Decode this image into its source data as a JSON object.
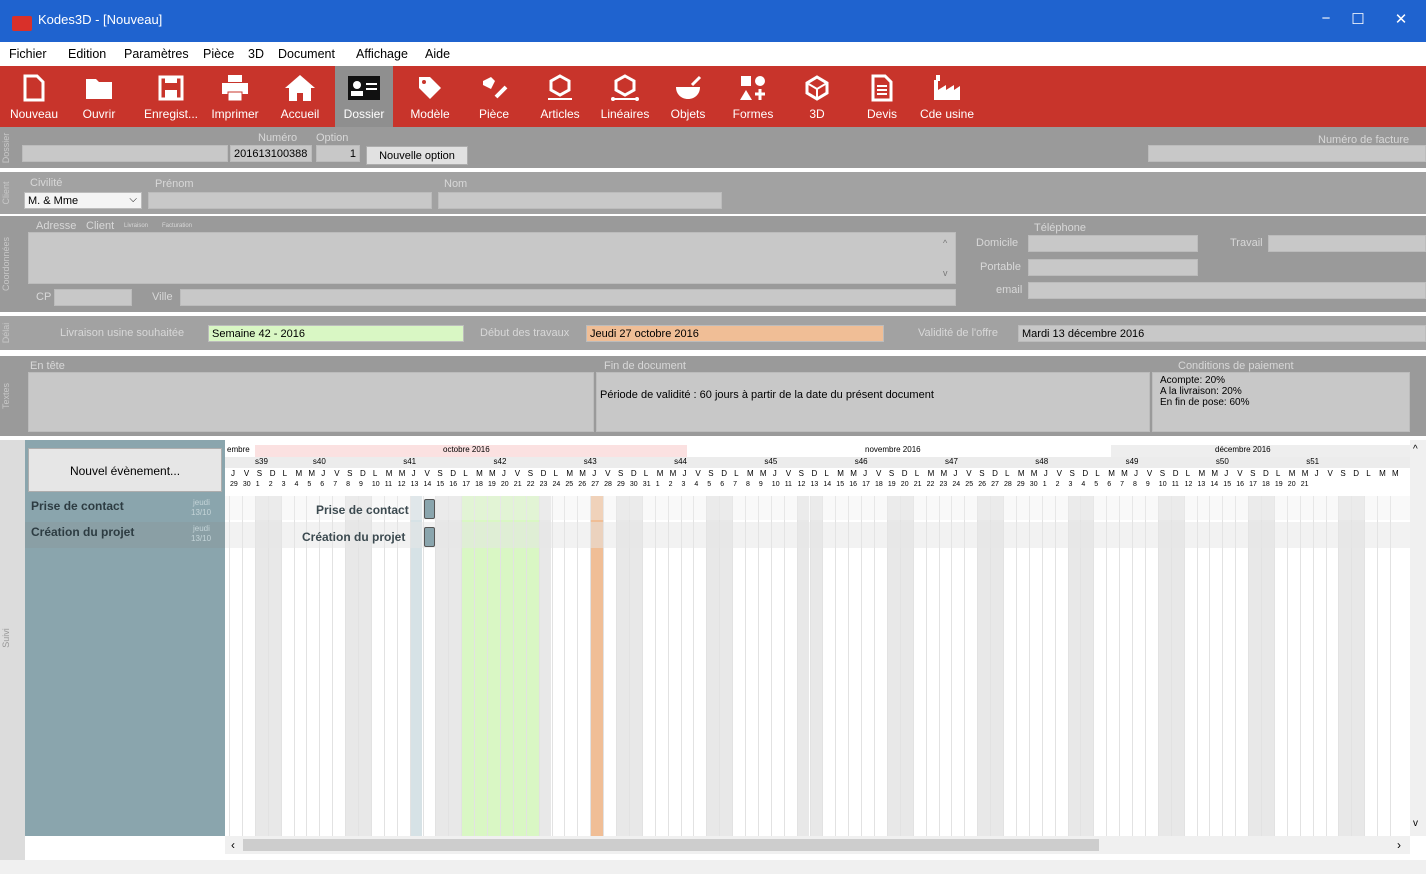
{
  "window": {
    "title": "Kodes3D - [Nouveau]",
    "min": "−",
    "max": "☐",
    "close": "✕"
  },
  "menu": [
    "Fichier",
    "Edition",
    "Paramètres",
    "Pièce",
    "3D",
    "Document",
    "Affichage",
    "Aide"
  ],
  "toolbar": [
    {
      "label": "Nouveau",
      "icon": "new-file-icon"
    },
    {
      "label": "Ouvrir",
      "icon": "folder-icon"
    },
    {
      "label": "Enregist...",
      "icon": "save-icon"
    },
    {
      "label": "Imprimer",
      "icon": "printer-icon"
    },
    {
      "label": "Accueil",
      "icon": "home-icon"
    },
    {
      "label": "Dossier",
      "icon": "id-card-icon"
    },
    {
      "label": "Modèle",
      "icon": "tag-icon"
    },
    {
      "label": "Pièce",
      "icon": "brush-icon"
    },
    {
      "label": "Articles",
      "icon": "articles-icon"
    },
    {
      "label": "Linéaires",
      "icon": "linear-icon"
    },
    {
      "label": "Objets",
      "icon": "objects-icon"
    },
    {
      "label": "Formes",
      "icon": "shapes-icon"
    },
    {
      "label": "3D",
      "icon": "cube-icon"
    },
    {
      "label": "Devis",
      "icon": "document-icon"
    },
    {
      "label": "Cde usine",
      "icon": "factory-icon"
    }
  ],
  "dossier": {
    "section": "Dossier",
    "numero_label": "Numéro",
    "numero": "201613100388",
    "option_label": "Option",
    "option": "1",
    "new_option": "Nouvelle option",
    "facture_label": "Numéro de facture"
  },
  "client": {
    "section": "Client",
    "civilite_label": "Civilité",
    "civilite": "M. & Mme",
    "prenom_label": "Prénom",
    "nom_label": "Nom"
  },
  "coordonnees": {
    "section": "Coordonnées",
    "adresse_label": "Adresse",
    "client_label": "Client",
    "livraison": "Livraison",
    "facturation": "Facturation",
    "cp_label": "CP",
    "ville_label": "Ville",
    "telephone_label": "Téléphone",
    "domicile_label": "Domicile",
    "portable_label": "Portable",
    "email_label": "email",
    "travail_label": "Travail"
  },
  "delai": {
    "section": "Délai",
    "livraison_label": "Livraison usine souhaitée",
    "livraison": "Semaine 42 - 2016",
    "debut_label": "Début des travaux",
    "debut": "Jeudi 27 octobre 2016",
    "validite_label": "Validité de l'offre",
    "validite": "Mardi 13 décembre 2016"
  },
  "textes": {
    "section": "Textes",
    "entete_label": "En tête",
    "fin_label": "Fin de document",
    "fin_text": "Période de validité  : 60 jours à partir de la date du présent document",
    "conditions_label": "Conditions de paiement",
    "conditions": [
      "Acompte: 20%",
      "A la livraison: 20%",
      "En fin de pose: 60%"
    ]
  },
  "suivi": {
    "section": "Suivi",
    "new_event": "Nouvel évènement...",
    "events": [
      {
        "name": "Prise de contact",
        "date1": "jeudi",
        "date2": "13/10"
      },
      {
        "name": "Création du projet",
        "date1": "jeudi",
        "date2": "13/10"
      }
    ],
    "months": [
      "embre",
      "octobre 2016",
      "novembre 2016",
      "décembre 2016"
    ],
    "weeks": [
      "s39",
      "s40",
      "s41",
      "s42",
      "s43",
      "s44",
      "s45",
      "s46",
      "s47",
      "s48",
      "s49",
      "s50",
      "s51"
    ],
    "days": [
      "J",
      "V",
      "S",
      "D",
      "L",
      "M",
      "M",
      "J",
      "V",
      "S",
      "D",
      "L",
      "M",
      "M",
      "J",
      "V",
      "S",
      "D",
      "L",
      "M",
      "M",
      "J",
      "V",
      "S",
      "D",
      "L",
      "M",
      "M",
      "J",
      "V",
      "S",
      "D",
      "L",
      "M",
      "M",
      "J",
      "V",
      "S",
      "D",
      "L",
      "M",
      "M",
      "J",
      "V",
      "S",
      "D",
      "L",
      "M",
      "M",
      "J",
      "V",
      "S",
      "D",
      "L",
      "M",
      "M",
      "J",
      "V",
      "S",
      "D",
      "L",
      "M",
      "M",
      "J",
      "V",
      "S",
      "D",
      "L",
      "M",
      "M",
      "J",
      "V",
      "S",
      "D",
      "L",
      "M",
      "M",
      "J",
      "V",
      "S",
      "D",
      "L",
      "M",
      "M",
      "J",
      "V",
      "S",
      "D",
      "L",
      "M",
      "M"
    ],
    "dates": [
      "29",
      "30",
      "1",
      "2",
      "3",
      "4",
      "5",
      "6",
      "7",
      "8",
      "9",
      "10",
      "11",
      "12",
      "13",
      "14",
      "15",
      "16",
      "17",
      "18",
      "19",
      "20",
      "21",
      "22",
      "23",
      "24",
      "25",
      "26",
      "27",
      "28",
      "29",
      "30",
      "31",
      "1",
      "2",
      "3",
      "4",
      "5",
      "6",
      "7",
      "8",
      "9",
      "10",
      "11",
      "12",
      "13",
      "14",
      "15",
      "16",
      "17",
      "18",
      "19",
      "20",
      "21",
      "22",
      "23",
      "24",
      "25",
      "26",
      "27",
      "28",
      "29",
      "30",
      "1",
      "2",
      "3",
      "4",
      "5",
      "6",
      "7",
      "8",
      "9",
      "10",
      "11",
      "12",
      "13",
      "14",
      "15",
      "16",
      "17",
      "18",
      "19",
      "20",
      "21"
    ]
  },
  "colors": {
    "toolbar": "#c8342b",
    "title": "#1f63cf",
    "green": "#d9f7c4",
    "orange": "#f0be96",
    "panel": "#8aa5ad"
  }
}
